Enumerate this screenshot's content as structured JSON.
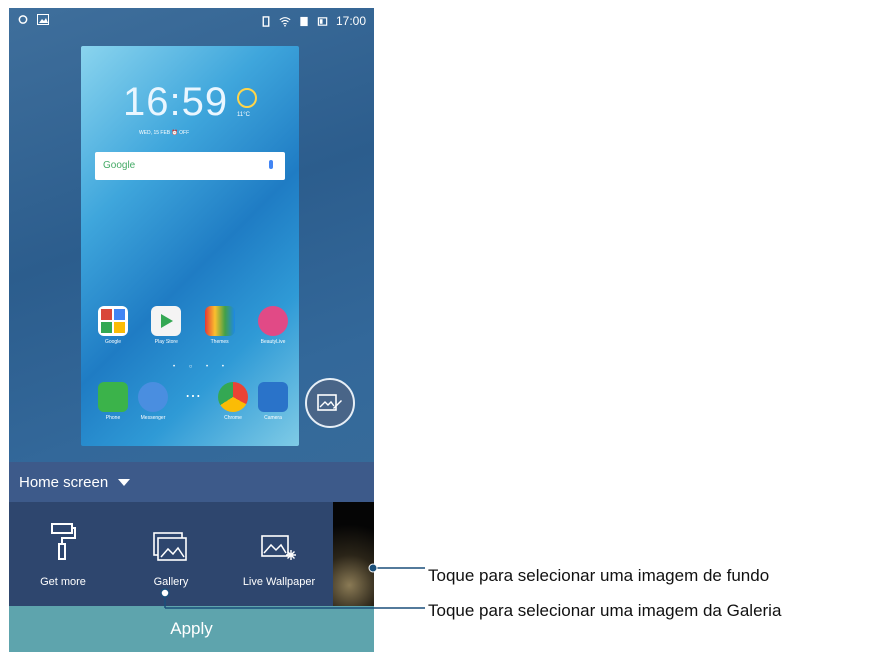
{
  "status_bar": {
    "time": "17:00"
  },
  "preview": {
    "clock_time": "16:59",
    "date": "WED, 15 FEB",
    "alarm": "OFF",
    "temperature": "11°C",
    "search_brand": "Google",
    "apps": [
      {
        "label": "Google",
        "color": "#d9473a"
      },
      {
        "label": "Play Store",
        "color": "#f4f4f4"
      },
      {
        "label": "Themes",
        "color": "#f08a24"
      },
      {
        "label": "BeautyLive",
        "color": "#e14a86"
      }
    ],
    "dock": [
      {
        "label": "Phone",
        "color": "#3bb34a"
      },
      {
        "label": "Messenger",
        "color": "#4a8ee0"
      },
      {
        "label": "",
        "color": "transparent"
      },
      {
        "label": "Chrome",
        "color": "#f1c232"
      },
      {
        "label": "Camera",
        "color": "#2a73c9"
      }
    ]
  },
  "home_screen_label": "Home screen",
  "options": [
    {
      "label": "Get more",
      "icon": "paint-roller-icon"
    },
    {
      "label": "Gallery",
      "icon": "gallery-icon"
    },
    {
      "label": "Live Wallpaper",
      "icon": "live-wallpaper-icon"
    }
  ],
  "apply_label": "Apply",
  "callouts": [
    {
      "text": "Toque para selecionar uma imagem de fundo"
    },
    {
      "text": "Toque para selecionar uma imagem da Galeria"
    }
  ]
}
